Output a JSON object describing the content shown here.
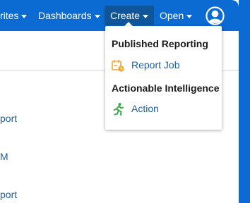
{
  "navbar": {
    "items": [
      {
        "label": "rites"
      },
      {
        "label": "Dashboards"
      },
      {
        "label": "Create"
      },
      {
        "label": "Open"
      }
    ],
    "user_icon": "user-circle-icon"
  },
  "side_links": [
    "port",
    "M",
    "port"
  ],
  "create_menu": {
    "sections": [
      {
        "header": "Published Reporting",
        "items": [
          {
            "label": "Report Job",
            "icon": "report-job-icon"
          }
        ]
      },
      {
        "header": "Actionable Intelligence",
        "items": [
          {
            "label": "Action",
            "icon": "running-figure-icon"
          }
        ]
      }
    ]
  },
  "colors": {
    "navbar": "#0b6bd3",
    "active_nav": "#0e559a",
    "link": "#1f5f9f",
    "report_icon": "#f0a83a",
    "action_icon": "#3ea94b"
  }
}
